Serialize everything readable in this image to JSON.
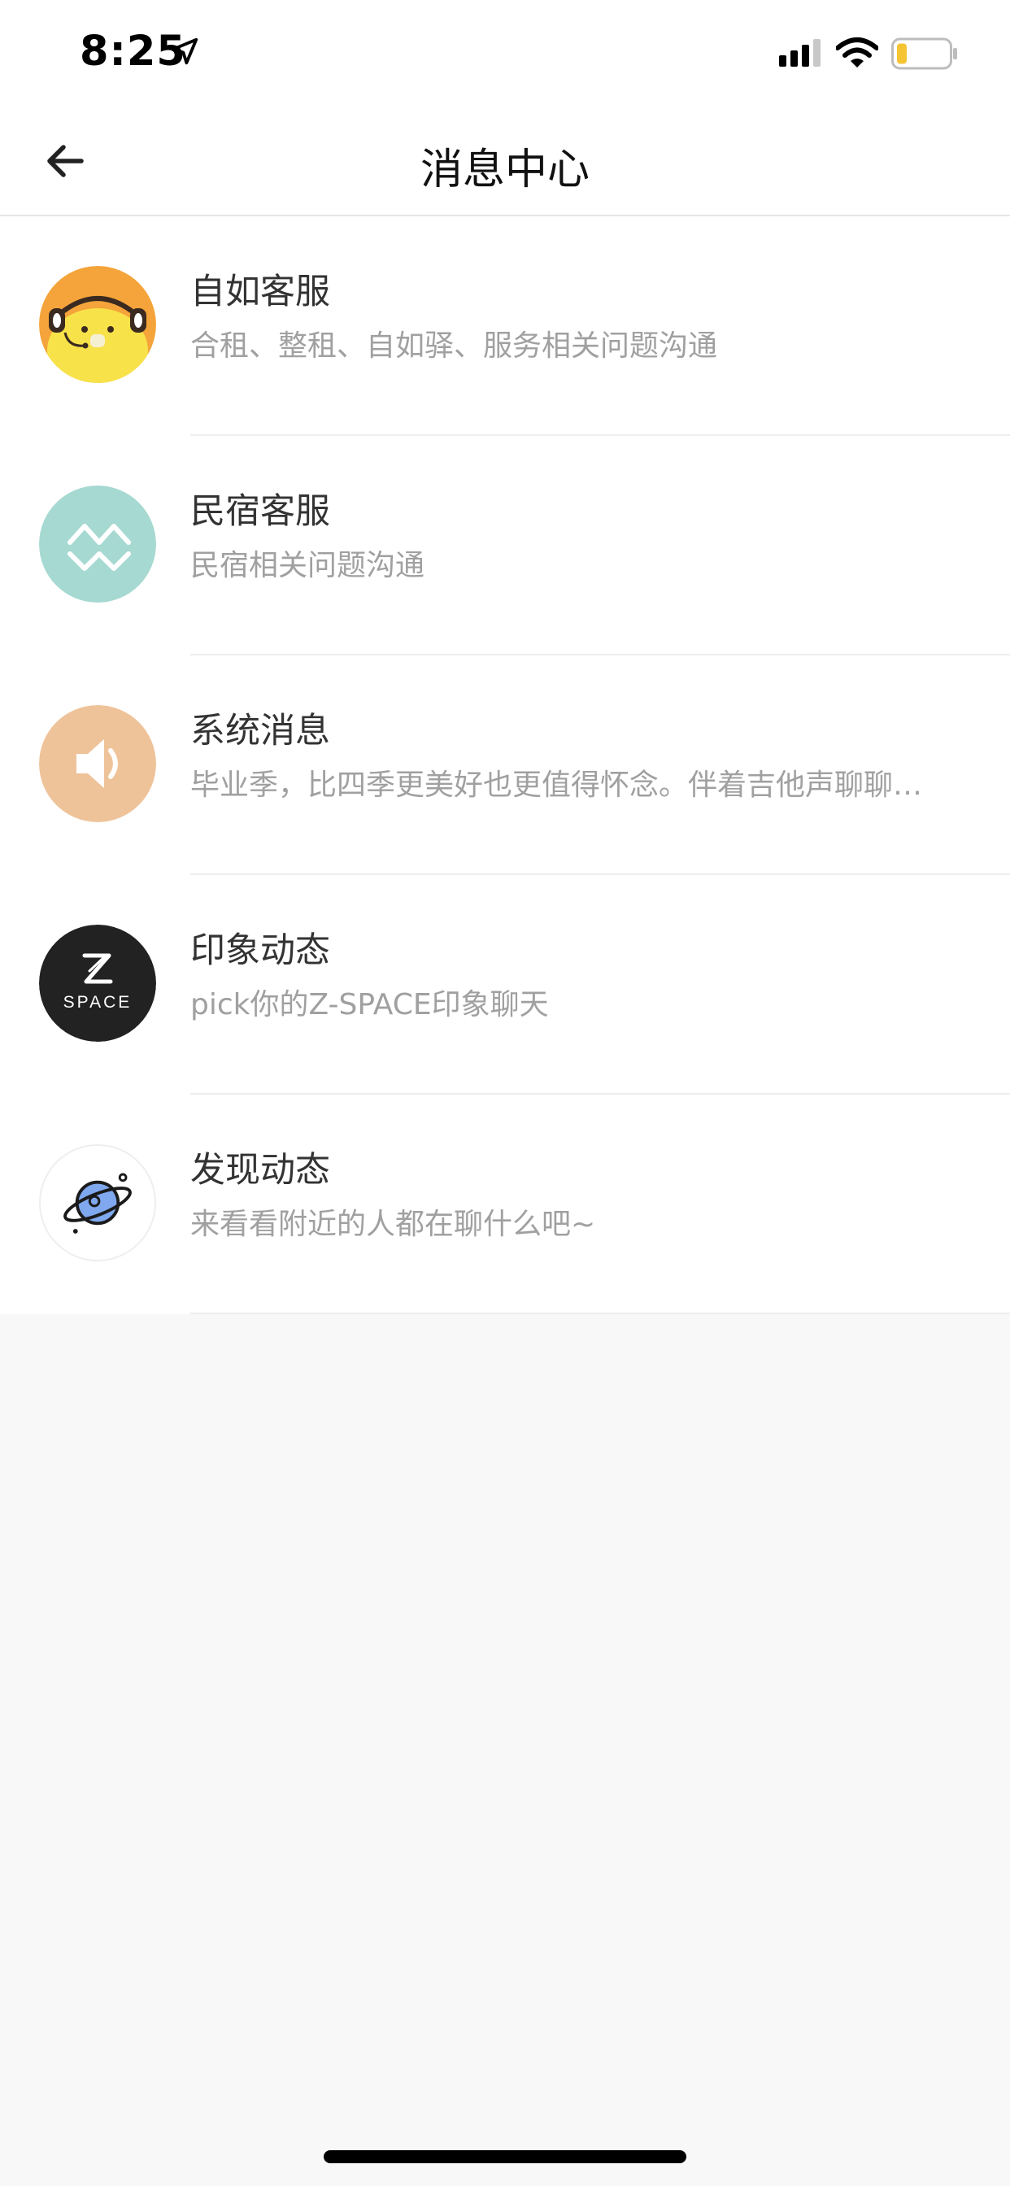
{
  "status_bar": {
    "time": "8:25",
    "icons": [
      "location-arrow-icon",
      "cellular-signal-icon",
      "wifi-icon",
      "battery-icon"
    ],
    "battery_color": "#f5c435"
  },
  "nav": {
    "title": "消息中心",
    "back_icon": "arrow-left-icon"
  },
  "messages": [
    {
      "title": "自如客服",
      "subtitle": "合租、整租、自如驿、服务相关问题沟通",
      "avatar": "bear-headphones",
      "avatar_color": "#f4a43a"
    },
    {
      "title": "民宿客服",
      "subtitle": "民宿相关问题沟通",
      "avatar": "minsu-logo",
      "avatar_color": "#a6d9d1"
    },
    {
      "title": "系统消息",
      "subtitle": "毕业季，比四季更美好也更值得怀念。伴着吉他声聊聊…",
      "avatar": "speaker",
      "avatar_color": "#efc39a"
    },
    {
      "title": "印象动态",
      "subtitle": "pick你的Z-SPACE印象聊天",
      "avatar": "z-space-logo",
      "avatar_color": "#222222",
      "avatar_text": "SPACE"
    },
    {
      "title": "发现动态",
      "subtitle": "来看看附近的人都在聊什么吧~",
      "avatar": "planet",
      "avatar_color": "#ffffff"
    }
  ]
}
